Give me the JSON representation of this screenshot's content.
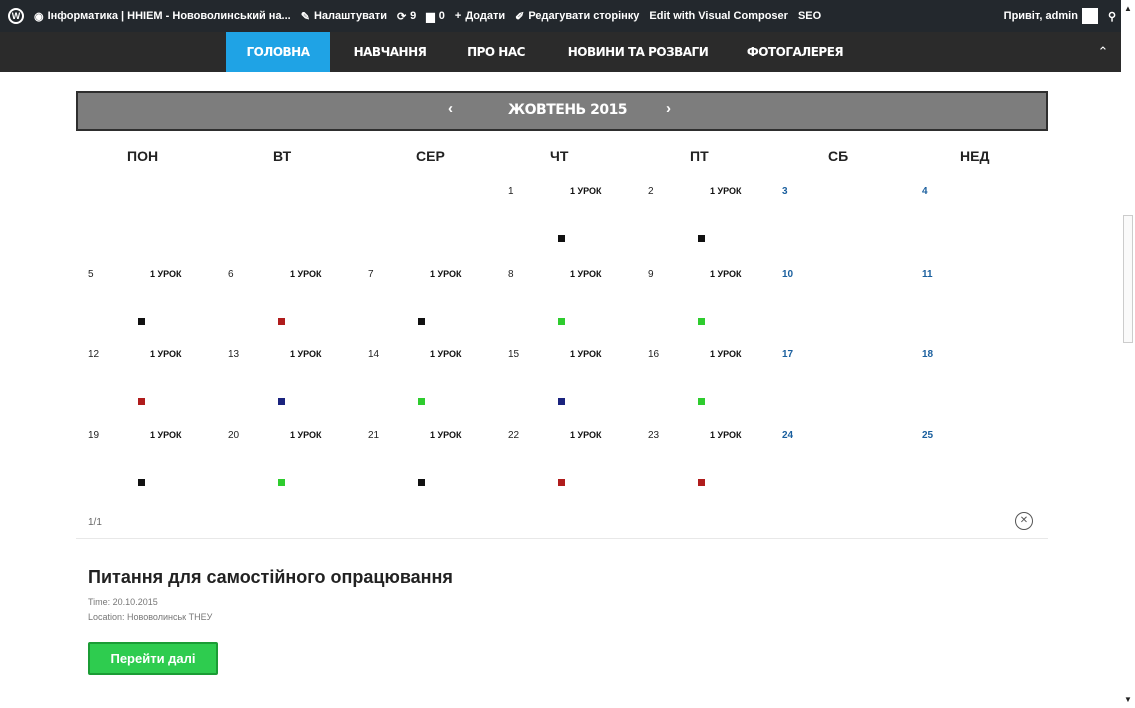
{
  "adminbar": {
    "site_name": "Інформатика | ННІЕМ - Нововолинський на...",
    "customize": "Налаштувати",
    "updates_count": "9",
    "comments_count": "0",
    "add_new": "Додати",
    "edit_page": "Редагувати сторінку",
    "visual_composer": "Edit with Visual Composer",
    "seo": "SEO",
    "greeting": "Привіт, admin"
  },
  "nav": {
    "items": [
      {
        "label": "ГОЛОВНА"
      },
      {
        "label": "НАВЧАННЯ"
      },
      {
        "label": "ПРО НАС"
      },
      {
        "label": "НОВИНИ ТА РОЗВАГИ"
      },
      {
        "label": "ФОТОГАЛЕРЕЯ"
      }
    ],
    "active_index": 0
  },
  "calendar": {
    "month_label": "ЖОВТЕНЬ 2015",
    "weekdays": [
      "ПОН",
      "ВТ",
      "СЕР",
      "ЧТ",
      "ПТ",
      "СБ",
      "НЕД"
    ],
    "lesson_label": "1 УРОК",
    "marker_colors": {
      "black": "#111111",
      "red": "#b01c1c",
      "green": "#2ecc2e",
      "blue": "#1a237e"
    },
    "weeks": [
      [
        null,
        null,
        null,
        {
          "day": "1",
          "lesson": true,
          "marker": "black"
        },
        {
          "day": "2",
          "lesson": true,
          "marker": "black"
        },
        {
          "day": "3",
          "weekend": true
        },
        {
          "day": "4",
          "weekend": true
        }
      ],
      [
        {
          "day": "5",
          "lesson": true,
          "marker": "black"
        },
        {
          "day": "6",
          "lesson": true,
          "marker": "red"
        },
        {
          "day": "7",
          "lesson": true,
          "marker": "black"
        },
        {
          "day": "8",
          "lesson": true,
          "marker": "green"
        },
        {
          "day": "9",
          "lesson": true,
          "marker": "green"
        },
        {
          "day": "10",
          "weekend": true
        },
        {
          "day": "11",
          "weekend": true
        }
      ],
      [
        {
          "day": "12",
          "lesson": true,
          "marker": "red"
        },
        {
          "day": "13",
          "lesson": true,
          "marker": "blue"
        },
        {
          "day": "14",
          "lesson": true,
          "marker": "green"
        },
        {
          "day": "15",
          "lesson": true,
          "marker": "blue"
        },
        {
          "day": "16",
          "lesson": true,
          "marker": "green"
        },
        {
          "day": "17",
          "weekend": true
        },
        {
          "day": "18",
          "weekend": true
        }
      ],
      [
        {
          "day": "19",
          "lesson": true,
          "marker": "black"
        },
        {
          "day": "20",
          "lesson": true,
          "marker": "green"
        },
        {
          "day": "21",
          "lesson": true,
          "marker": "black"
        },
        {
          "day": "22",
          "lesson": true,
          "marker": "red"
        },
        {
          "day": "23",
          "lesson": true,
          "marker": "red"
        },
        {
          "day": "24",
          "weekend": true
        },
        {
          "day": "25",
          "weekend": true
        }
      ]
    ]
  },
  "pagination": {
    "label": "1/1"
  },
  "event": {
    "title": "Питання для самостійного опрацювання",
    "time": "Time: 20.10.2015",
    "location": "Location: Нововолинськ ТНЕУ",
    "button_label": "Перейти далі"
  }
}
